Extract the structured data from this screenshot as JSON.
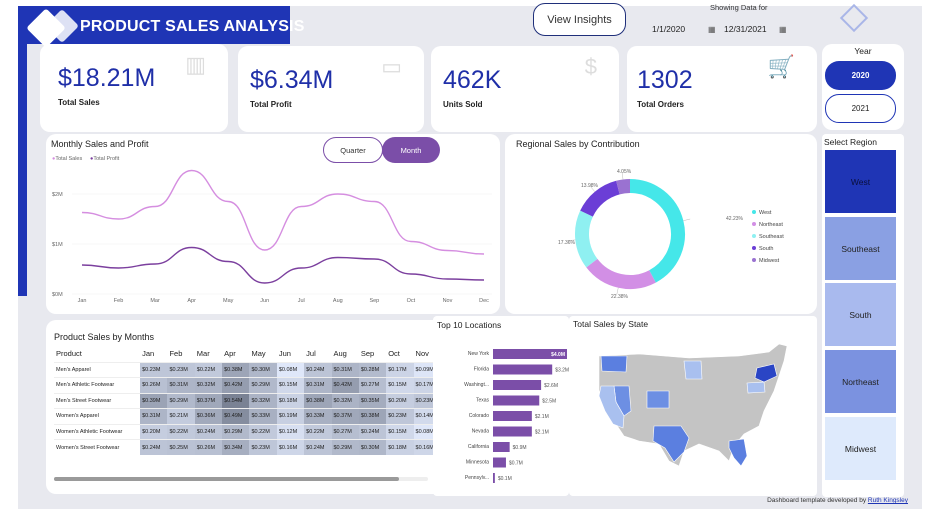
{
  "header": {
    "title": "PRODUCT SALES ANALYSIS",
    "insights_button": "View Insights",
    "showing_label": "Showing Data for",
    "date_from": "1/1/2020",
    "date_to": "12/31/2021"
  },
  "kpis": [
    {
      "value": "$18.21M",
      "label": "Total Sales",
      "icon": "bar-chart-icon"
    },
    {
      "value": "$6.34M",
      "label": "Total Profit",
      "icon": "wallet-icon"
    },
    {
      "value": "462K",
      "label": "Units Sold",
      "icon": "dollar-icon"
    },
    {
      "value": "1302",
      "label": "Total Orders",
      "icon": "cart-icon"
    }
  ],
  "year_filter": {
    "title": "Year",
    "options": [
      "2020",
      "2021"
    ],
    "selected": "2020"
  },
  "region_filter": {
    "title": "Select Region",
    "options": [
      {
        "label": "West",
        "color": "#1f35b5",
        "selected": true
      },
      {
        "label": "Southeast",
        "color": "#8aa0e3",
        "selected": false
      },
      {
        "label": "South",
        "color": "#a9baee",
        "selected": false
      },
      {
        "label": "Northeast",
        "color": "#7b92e0",
        "selected": false
      },
      {
        "label": "Midwest",
        "color": "#deeafc",
        "selected": false
      }
    ]
  },
  "line_chart": {
    "title": "Monthly Sales and Profit",
    "toggle": [
      "Quarter",
      "Month"
    ],
    "toggle_selected": "Month"
  },
  "donut_chart": {
    "title": "Regional Sales by Contribution"
  },
  "table": {
    "title": "Product Sales by Months",
    "columns": [
      "Product",
      "Jan",
      "Feb",
      "Mar",
      "Apr",
      "May",
      "Jun",
      "Jul",
      "Aug",
      "Sep",
      "Oct",
      "Nov"
    ],
    "rows": [
      {
        "name": "Men's Apparel",
        "values": [
          "$0.23M",
          "$0.23M",
          "$0.22M",
          "$0.38M",
          "$0.30M",
          "$0.08M",
          "$0.24M",
          "$0.31M",
          "$0.28M",
          "$0.17M",
          "$0.09M"
        ]
      },
      {
        "name": "Men's Athletic Footwear",
        "values": [
          "$0.26M",
          "$0.31M",
          "$0.32M",
          "$0.42M",
          "$0.29M",
          "$0.15M",
          "$0.31M",
          "$0.42M",
          "$0.27M",
          "$0.15M",
          "$0.17M"
        ]
      },
      {
        "name": "Men's Street Footwear",
        "values": [
          "$0.39M",
          "$0.29M",
          "$0.37M",
          "$0.54M",
          "$0.32M",
          "$0.18M",
          "$0.38M",
          "$0.32M",
          "$0.35M",
          "$0.20M",
          "$0.23M"
        ]
      },
      {
        "name": "Women's Apparel",
        "values": [
          "$0.31M",
          "$0.21M",
          "$0.36M",
          "$0.49M",
          "$0.33M",
          "$0.19M",
          "$0.33M",
          "$0.37M",
          "$0.38M",
          "$0.23M",
          "$0.14M"
        ]
      },
      {
        "name": "Women's Athletic Footwear",
        "values": [
          "$0.20M",
          "$0.22M",
          "$0.24M",
          "$0.29M",
          "$0.22M",
          "$0.12M",
          "$0.22M",
          "$0.27M",
          "$0.24M",
          "$0.15M",
          "$0.08M"
        ]
      },
      {
        "name": "Women's Street Footwear",
        "values": [
          "$0.24M",
          "$0.25M",
          "$0.26M",
          "$0.34M",
          "$0.23M",
          "$0.16M",
          "$0.24M",
          "$0.29M",
          "$0.30M",
          "$0.18M",
          "$0.16M"
        ]
      }
    ]
  },
  "bar_title": "Top 10 Locations",
  "map_title": "Total Sales by State",
  "footer": {
    "text": "Dashboard template developed by",
    "author": "Ruth Kingsley"
  },
  "chart_data": [
    {
      "type": "line",
      "title": "Monthly Sales and Profit",
      "x": [
        "Jan",
        "Feb",
        "Mar",
        "Apr",
        "May",
        "Jun",
        "Jul",
        "Aug",
        "Sep",
        "Oct",
        "Nov",
        "Dec"
      ],
      "series": [
        {
          "name": "Total Sales",
          "color": "#d58ee0",
          "values": [
            1.63,
            1.5,
            1.75,
            2.47,
            1.85,
            0.88,
            1.75,
            2.0,
            1.85,
            1.05,
            0.87,
            0.8
          ]
        },
        {
          "name": "Total Profit",
          "color": "#7b3f9e",
          "values": [
            0.58,
            0.52,
            0.6,
            0.93,
            0.65,
            0.22,
            0.52,
            0.73,
            0.7,
            0.4,
            0.3,
            0.28
          ]
        }
      ],
      "ylim": [
        0,
        2.6
      ],
      "yticks": [
        "$0M",
        "$1M",
        "$2M"
      ],
      "legend": "top-left"
    },
    {
      "type": "pie",
      "title": "Regional Sales by Contribution",
      "categories": [
        "West",
        "Northeast",
        "Southeast",
        "South",
        "Midwest"
      ],
      "values": [
        42.23,
        22.38,
        17.36,
        13.98,
        4.05
      ],
      "labels": [
        "42.23%",
        "22.38%",
        "17.36%",
        "13.98%",
        "4.05%"
      ],
      "colors": [
        "#45e7e9",
        "#d28fe5",
        "#8ff0f1",
        "#6b3ed6",
        "#9a72d1"
      ],
      "legend": "right"
    },
    {
      "type": "bar",
      "title": "Top 10 Locations",
      "categories": [
        "New York",
        "Florida",
        "Washingt...",
        "Texas",
        "Colorado",
        "Nevada",
        "California",
        "Minnesota",
        "Pennsylv..."
      ],
      "values": [
        4.0,
        3.2,
        2.6,
        2.5,
        2.1,
        2.1,
        0.9,
        0.7,
        0.1
      ],
      "labels": [
        "$4.0M",
        "$3.2M",
        "$2.6M",
        "$2.5M",
        "$2.1M",
        "$2.1M",
        "$0.9M",
        "$0.7M",
        "$0.1M"
      ],
      "color": "#7b4ea8"
    }
  ]
}
